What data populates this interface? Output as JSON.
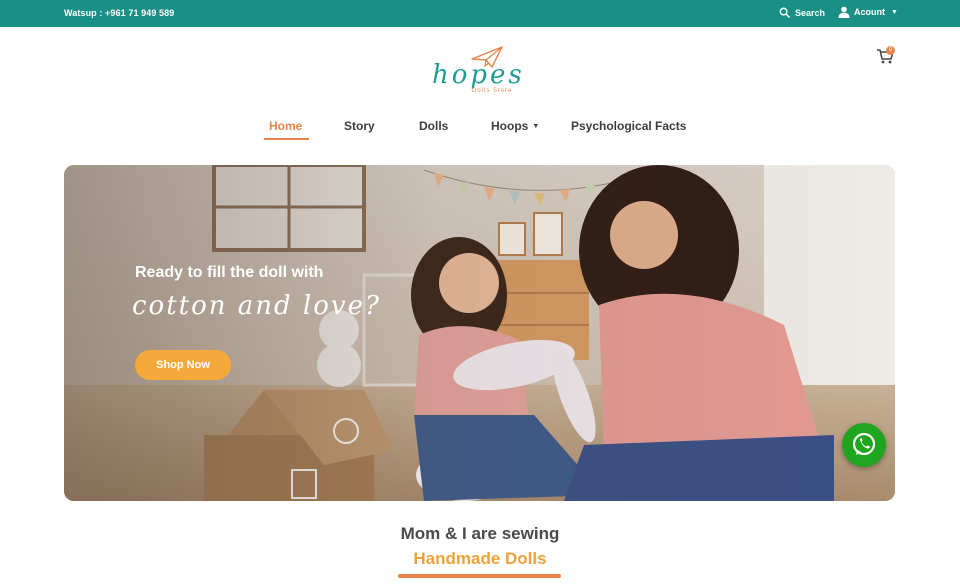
{
  "topbar": {
    "phone": "Watsup : +961 71 949 589",
    "search_label": "Search",
    "account_label": "Acount"
  },
  "logo": {
    "brand": "hopes",
    "sub": "Dolls Store"
  },
  "cart": {
    "count": "0"
  },
  "nav": {
    "items": [
      {
        "label": "Home"
      },
      {
        "label": "Story"
      },
      {
        "label": "Dolls"
      },
      {
        "label": "Hoops"
      },
      {
        "label": "Psychological Facts"
      }
    ]
  },
  "hero": {
    "headline": "Ready to fill the doll with",
    "script": "cotton and love?",
    "cta": "Shop Now"
  },
  "section": {
    "title": "Mom & I are sewing",
    "subtitle": "Handmade Dolls"
  },
  "colors": {
    "topbar": "#1a8f86",
    "accent_orange": "#e8834a",
    "cta_yellow": "#f6a93b",
    "whatsapp_green": "#1fa51f"
  },
  "icons": {
    "search": "search-icon",
    "account": "user-icon",
    "cart": "cart-icon",
    "whatsapp": "whatsapp-icon"
  }
}
